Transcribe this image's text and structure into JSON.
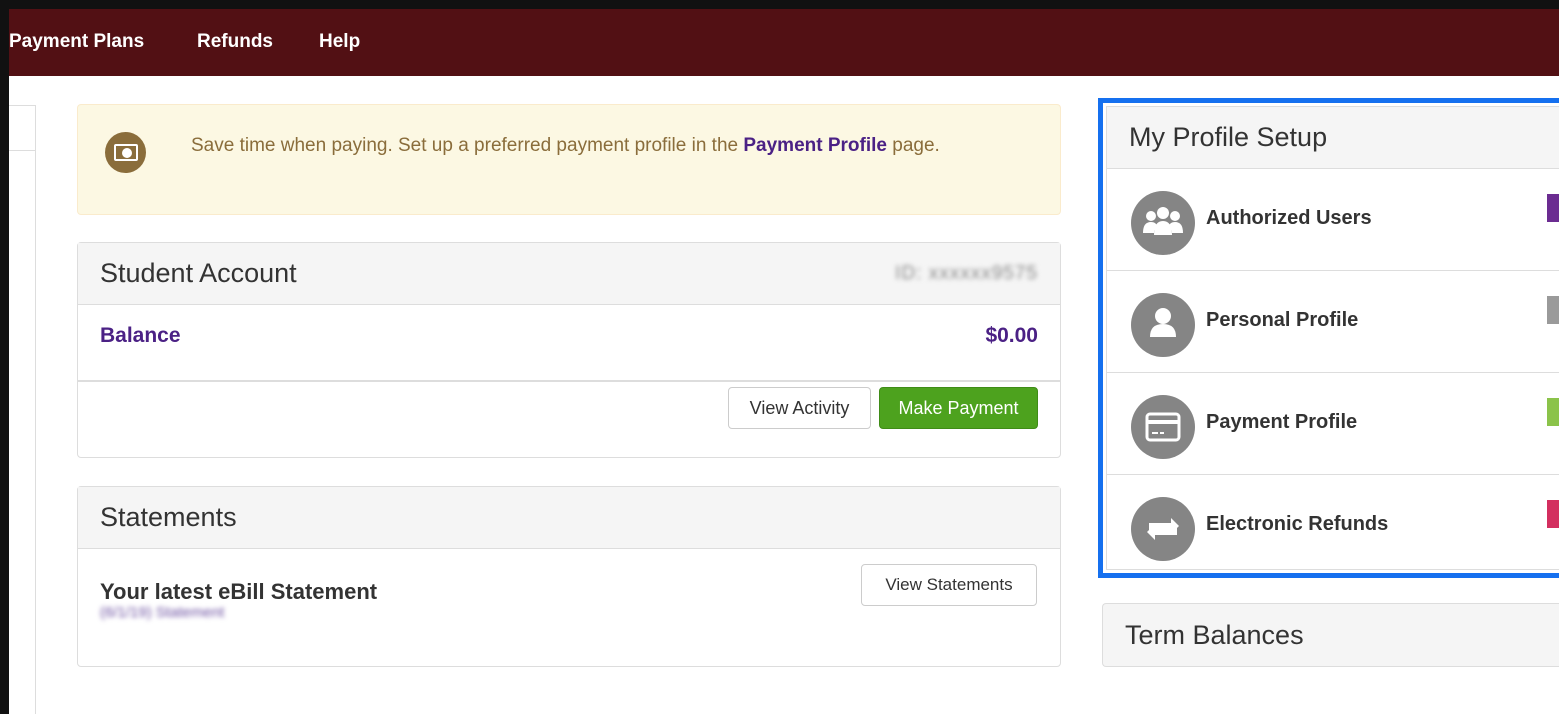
{
  "nav": {
    "items": [
      "Payment Plans",
      "Refunds",
      "Help"
    ]
  },
  "alert": {
    "text_before": "Save time when paying. Set up a preferred payment profile in the ",
    "link": "Payment Profile",
    "text_after": " page."
  },
  "account": {
    "title": "Student Account",
    "id_blurred": "ID: xxxxxx9575",
    "balance_label": "Balance",
    "balance_value": "$0.00",
    "view_activity": "View Activity",
    "make_payment": "Make Payment"
  },
  "statements": {
    "title": "Statements",
    "latest_label": "Your latest eBill Statement",
    "latest_sub_blurred": "(6/1/19) Statement",
    "view_button": "View Statements"
  },
  "profile": {
    "title": "My Profile Setup",
    "items": [
      {
        "label": "Authorized Users",
        "icon": "users-icon",
        "status_color": "#6b2c91"
      },
      {
        "label": "Personal Profile",
        "icon": "user-icon",
        "status_color": "#9a9a9a"
      },
      {
        "label": "Payment Profile",
        "icon": "credit-card-icon",
        "status_color": "#8bc34a"
      },
      {
        "label": "Electronic Refunds",
        "icon": "refund-arrows-icon",
        "status_color": "#d32f5f"
      }
    ]
  },
  "term": {
    "title": "Term Balances"
  },
  "colors": {
    "nav_bg": "#521014",
    "accent_link": "#4b2185",
    "pay_button": "#4da21e",
    "highlight_border": "#1570ef"
  }
}
